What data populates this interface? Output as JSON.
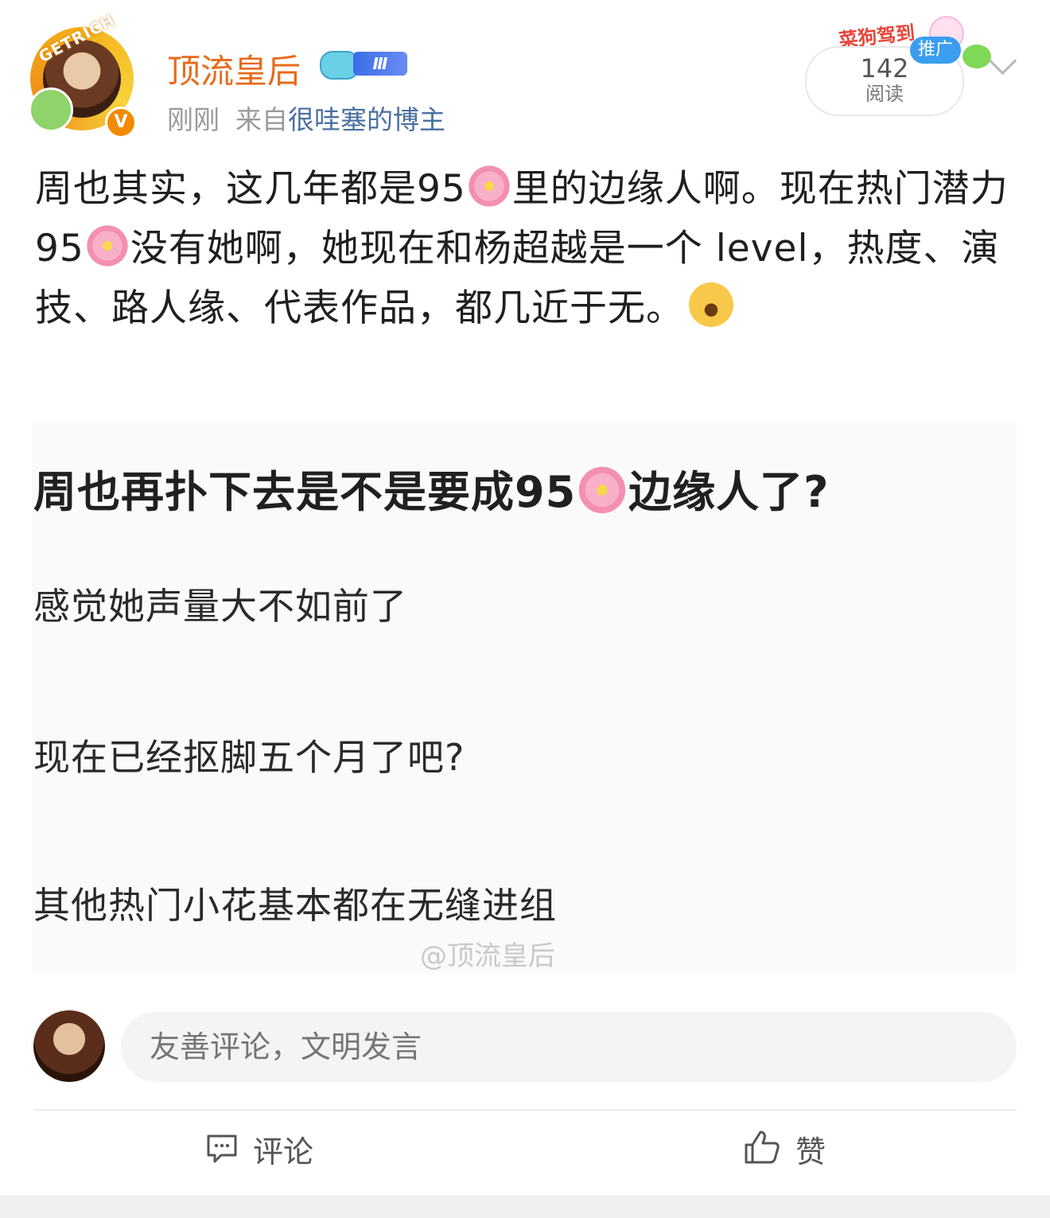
{
  "header": {
    "username": "顶流皇后",
    "level_badge": "Ⅲ",
    "avatar_text": "GETRICH",
    "verify_badge": "V",
    "time": "刚刚",
    "source_prefix": "来自",
    "source": "很哇塞的博主",
    "promo_art_text": "菜狗驾到",
    "read_count": "142",
    "read_label": "阅读",
    "promo_tag": "推广"
  },
  "post": {
    "text_part1": "周也其实，这几年都是95",
    "text_part2": "里的边缘人啊。现在热门潜力95",
    "text_part3": "没有她啊，她现在和杨超越是一个 level，热度、演技、路人缘、代表作品，都几近于无。",
    "emoji_flower": "flower-emoji",
    "emoji_laugh": "laugh-cry-emoji"
  },
  "embed": {
    "title_part1": "周也再扑下去是不是要成95",
    "title_part2": "边缘人了?",
    "lines": [
      "感觉她声量大不如前了",
      "现在已经抠脚五个月了吧?",
      "其他热门小花基本都在无缝进组"
    ],
    "watermark": "@顶流皇后"
  },
  "comment": {
    "placeholder": "友善评论，文明发言"
  },
  "actions": {
    "comment_label": "评论",
    "like_label": "赞"
  },
  "colors": {
    "username": "#e86a1c",
    "source_link": "#4a6fa0",
    "promo_tag": "#3a9df0",
    "text": "#1f1f1f"
  }
}
